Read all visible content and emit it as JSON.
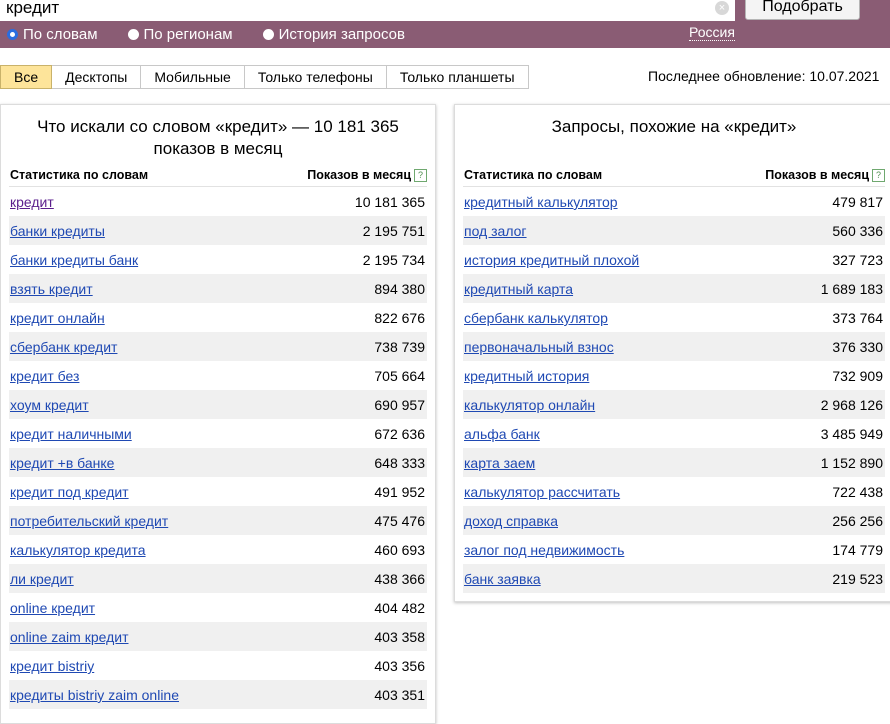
{
  "search": {
    "query": "кредит",
    "submit_label": "Подобрать",
    "clear": "×"
  },
  "modes": [
    {
      "label": "По словам",
      "checked": true
    },
    {
      "label": "По регионам",
      "checked": false
    },
    {
      "label": "История запросов",
      "checked": false
    }
  ],
  "region": "Россия",
  "device_tabs": [
    "Все",
    "Десктопы",
    "Мобильные",
    "Только телефоны",
    "Только планшеты"
  ],
  "active_tab": "Все",
  "last_update": "Последнее обновление: 10.07.2021",
  "left_panel": {
    "title_line1": "Что искали со словом «кредит» — 10 181 365",
    "title_line2": "показов в месяц",
    "col_keyword": "Статистика по словам",
    "col_count": "Показов в месяц",
    "help": "?",
    "rows": [
      {
        "keyword": "кредит",
        "count": "10 181 365"
      },
      {
        "keyword": "банки кредиты",
        "count": "2 195 751"
      },
      {
        "keyword": "банки кредиты банк",
        "count": "2 195 734"
      },
      {
        "keyword": "взять кредит",
        "count": "894 380"
      },
      {
        "keyword": "кредит онлайн",
        "count": "822 676"
      },
      {
        "keyword": "сбербанк кредит",
        "count": "738 739"
      },
      {
        "keyword": "кредит без",
        "count": "705 664"
      },
      {
        "keyword": "хоум кредит",
        "count": "690 957"
      },
      {
        "keyword": "кредит наличными",
        "count": "672 636"
      },
      {
        "keyword": "кредит +в банке",
        "count": "648 333"
      },
      {
        "keyword": "кредит под кредит",
        "count": "491 952"
      },
      {
        "keyword": "потребительский кредит",
        "count": "475 476"
      },
      {
        "keyword": "калькулятор кредита",
        "count": "460 693"
      },
      {
        "keyword": "ли кредит",
        "count": "438 366"
      },
      {
        "keyword": "online кредит",
        "count": "404 482"
      },
      {
        "keyword": "online zaim кредит",
        "count": "403 358"
      },
      {
        "keyword": "кредит bistriy",
        "count": "403 356"
      },
      {
        "keyword": "кредиты bistriy zaim online",
        "count": "403 351"
      }
    ]
  },
  "right_panel": {
    "title": "Запросы, похожие на «кредит»",
    "col_keyword": "Статистика по словам",
    "col_count": "Показов в месяц",
    "help": "?",
    "rows": [
      {
        "keyword": "кредитный калькулятор",
        "count": "479 817"
      },
      {
        "keyword": "под залог",
        "count": "560 336"
      },
      {
        "keyword": "история кредитный плохой",
        "count": "327 723"
      },
      {
        "keyword": "кредитный карта",
        "count": "1 689 183"
      },
      {
        "keyword": "сбербанк калькулятор",
        "count": "373 764"
      },
      {
        "keyword": "первоначальный взнос",
        "count": "376 330"
      },
      {
        "keyword": "кредитный история",
        "count": "732 909"
      },
      {
        "keyword": "калькулятор онлайн",
        "count": "2 968 126"
      },
      {
        "keyword": "альфа банк",
        "count": "3 485 949"
      },
      {
        "keyword": "карта заем",
        "count": "1 152 890"
      },
      {
        "keyword": "калькулятор рассчитать",
        "count": "722 438"
      },
      {
        "keyword": "доход справка",
        "count": "256 256"
      },
      {
        "keyword": "залог под недвижимость",
        "count": "174 779"
      },
      {
        "keyword": "банк заявка",
        "count": "219 523"
      }
    ]
  }
}
